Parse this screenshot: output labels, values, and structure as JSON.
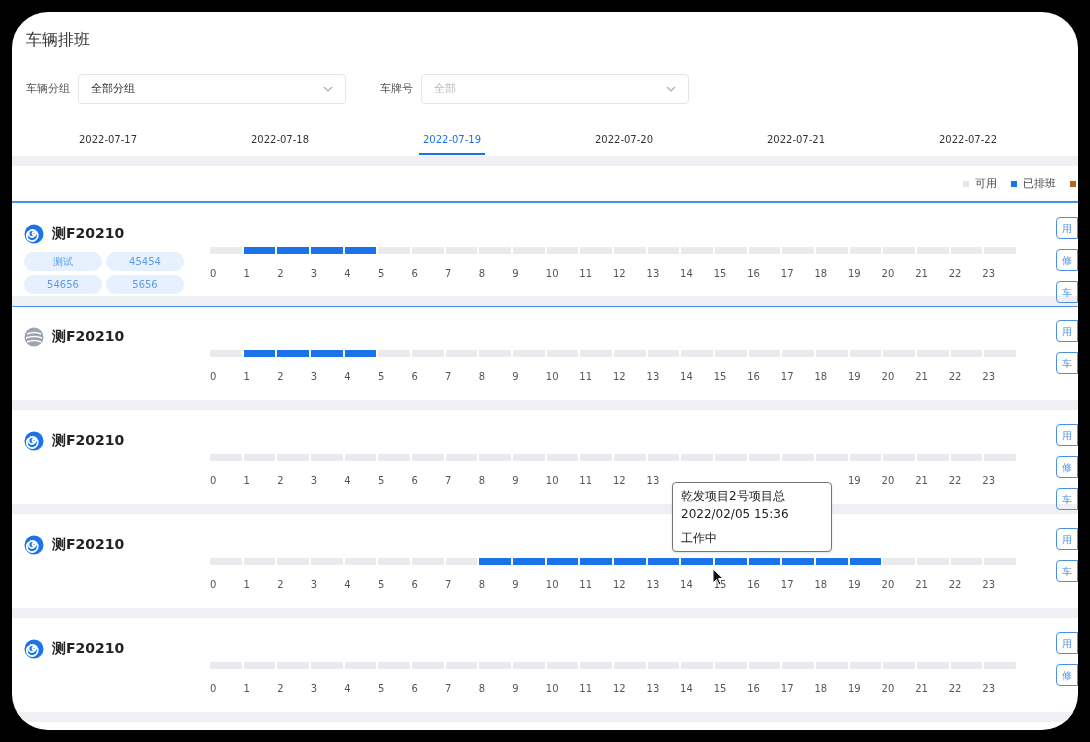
{
  "page_title": "车辆排班",
  "filters": [
    {
      "label": "车辆分组",
      "value": "全部分组"
    },
    {
      "label": "车牌号",
      "placeholder": "全部"
    }
  ],
  "date_tabs": [
    {
      "label": "2022-07-17",
      "selected": false
    },
    {
      "label": "2022-07-18",
      "selected": false
    },
    {
      "label": "2022-07-19",
      "selected": true
    },
    {
      "label": "2022-07-20",
      "selected": false
    },
    {
      "label": "2022-07-21",
      "selected": false
    },
    {
      "label": "2022-07-22",
      "selected": false
    }
  ],
  "legend": [
    {
      "label": "可用",
      "color": "#e5e7eb"
    },
    {
      "label": "已排班",
      "color": "#1a73e8"
    },
    {
      "color": "#b5651d"
    }
  ],
  "vehicles": [
    {
      "plate": "测F20210",
      "online": true,
      "selected": true,
      "tags": [
        "测试",
        "45454",
        "54656",
        "5656"
      ],
      "actions": [
        "用",
        "修",
        "车"
      ],
      "hours": [
        {
          "label": "0",
          "booked": false
        },
        {
          "label": "1",
          "booked": true
        },
        {
          "label": "2",
          "booked": true
        },
        {
          "label": "3",
          "booked": true
        },
        {
          "label": "4",
          "booked": true
        },
        {
          "label": "5",
          "booked": false
        },
        {
          "label": "6",
          "booked": false
        },
        {
          "label": "7",
          "booked": false
        },
        {
          "label": "8",
          "booked": false
        },
        {
          "label": "9",
          "booked": false
        },
        {
          "label": "10",
          "booked": false
        },
        {
          "label": "11",
          "booked": false
        },
        {
          "label": "12",
          "booked": false
        },
        {
          "label": "13",
          "booked": false
        },
        {
          "label": "14",
          "booked": false
        },
        {
          "label": "15",
          "booked": false
        },
        {
          "label": "16",
          "booked": false
        },
        {
          "label": "17",
          "booked": false
        },
        {
          "label": "18",
          "booked": false
        },
        {
          "label": "19",
          "booked": false
        },
        {
          "label": "20",
          "booked": false
        },
        {
          "label": "21",
          "booked": false
        },
        {
          "label": "22",
          "booked": false
        },
        {
          "label": "23",
          "booked": false
        }
      ]
    },
    {
      "plate": "测F20210",
      "online": false,
      "selected": false,
      "actions": [
        "用",
        "车"
      ],
      "hours": [
        {
          "label": "0",
          "booked": false
        },
        {
          "label": "1",
          "booked": true
        },
        {
          "label": "2",
          "booked": true
        },
        {
          "label": "3",
          "booked": true
        },
        {
          "label": "4",
          "booked": true
        },
        {
          "label": "5",
          "booked": false
        },
        {
          "label": "6",
          "booked": false
        },
        {
          "label": "7",
          "booked": false
        },
        {
          "label": "8",
          "booked": false
        },
        {
          "label": "9",
          "booked": false
        },
        {
          "label": "10",
          "booked": false
        },
        {
          "label": "11",
          "booked": false
        },
        {
          "label": "12",
          "booked": false
        },
        {
          "label": "13",
          "booked": false
        },
        {
          "label": "14",
          "booked": false
        },
        {
          "label": "15",
          "booked": false
        },
        {
          "label": "16",
          "booked": false
        },
        {
          "label": "17",
          "booked": false
        },
        {
          "label": "18",
          "booked": false
        },
        {
          "label": "19",
          "booked": false
        },
        {
          "label": "20",
          "booked": false
        },
        {
          "label": "21",
          "booked": false
        },
        {
          "label": "22",
          "booked": false
        },
        {
          "label": "23",
          "booked": false
        }
      ]
    },
    {
      "plate": "测F20210",
      "online": true,
      "selected": false,
      "actions": [
        "用",
        "修",
        "车"
      ],
      "hours": [
        {
          "label": "0",
          "booked": false
        },
        {
          "label": "1",
          "booked": false
        },
        {
          "label": "2",
          "booked": false
        },
        {
          "label": "3",
          "booked": false
        },
        {
          "label": "4",
          "booked": false
        },
        {
          "label": "5",
          "booked": false
        },
        {
          "label": "6",
          "booked": false
        },
        {
          "label": "7",
          "booked": false
        },
        {
          "label": "8",
          "booked": false
        },
        {
          "label": "9",
          "booked": false
        },
        {
          "label": "10",
          "booked": false
        },
        {
          "label": "11",
          "booked": false
        },
        {
          "label": "12",
          "booked": false
        },
        {
          "label": "13",
          "booked": false
        },
        {
          "booked": false
        },
        {
          "booked": false
        },
        {
          "booked": false
        },
        {
          "booked": false
        },
        {
          "booked": false
        },
        {
          "label": "19",
          "booked": false
        },
        {
          "label": "20",
          "booked": false
        },
        {
          "label": "21",
          "booked": false
        },
        {
          "label": "22",
          "booked": false
        },
        {
          "label": "23",
          "booked": false
        }
      ]
    },
    {
      "plate": "测F20210",
      "online": true,
      "selected": false,
      "actions": [
        "用",
        "车"
      ],
      "hours": [
        {
          "label": "0",
          "booked": false
        },
        {
          "label": "1",
          "booked": false
        },
        {
          "label": "2",
          "booked": false
        },
        {
          "label": "3",
          "booked": false
        },
        {
          "label": "4",
          "booked": false
        },
        {
          "label": "5",
          "booked": false
        },
        {
          "label": "6",
          "booked": false
        },
        {
          "label": "7",
          "booked": false
        },
        {
          "label": "8",
          "booked": true
        },
        {
          "label": "9",
          "booked": true
        },
        {
          "label": "10",
          "booked": true
        },
        {
          "label": "11",
          "booked": true
        },
        {
          "label": "12",
          "booked": true
        },
        {
          "label": "13",
          "booked": true
        },
        {
          "label": "14",
          "booked": true
        },
        {
          "label": "15",
          "booked": true
        },
        {
          "label": "16",
          "booked": true
        },
        {
          "label": "17",
          "booked": true
        },
        {
          "label": "18",
          "booked": true
        },
        {
          "label": "19",
          "booked": true
        },
        {
          "label": "20",
          "booked": false
        },
        {
          "label": "21",
          "booked": false
        },
        {
          "label": "22",
          "booked": false
        },
        {
          "label": "23",
          "booked": false
        }
      ]
    },
    {
      "plate": "测F20210",
      "online": true,
      "selected": false,
      "actions": [
        "用",
        "修"
      ],
      "hours": [
        {
          "label": "0",
          "booked": false
        },
        {
          "label": "1",
          "booked": false
        },
        {
          "label": "2",
          "booked": false
        },
        {
          "label": "3",
          "booked": false
        },
        {
          "label": "4",
          "booked": false
        },
        {
          "label": "5",
          "booked": false
        },
        {
          "label": "6",
          "booked": false
        },
        {
          "label": "7",
          "booked": false
        },
        {
          "label": "8",
          "booked": false
        },
        {
          "label": "9",
          "booked": false
        },
        {
          "label": "10",
          "booked": false
        },
        {
          "label": "11",
          "booked": false
        },
        {
          "label": "12",
          "booked": false
        },
        {
          "label": "13",
          "booked": false
        },
        {
          "label": "14",
          "booked": false
        },
        {
          "label": "15",
          "booked": false
        },
        {
          "label": "16",
          "booked": false
        },
        {
          "label": "17",
          "booked": false
        },
        {
          "label": "18",
          "booked": false
        },
        {
          "label": "19",
          "booked": false
        },
        {
          "label": "20",
          "booked": false
        },
        {
          "label": "21",
          "booked": false
        },
        {
          "label": "22",
          "booked": false
        },
        {
          "label": "23",
          "booked": false
        }
      ]
    }
  ],
  "tooltip": {
    "lines": [
      "乾发项目2号项目总",
      "2022/02/05 15:36",
      "工作中"
    ]
  }
}
